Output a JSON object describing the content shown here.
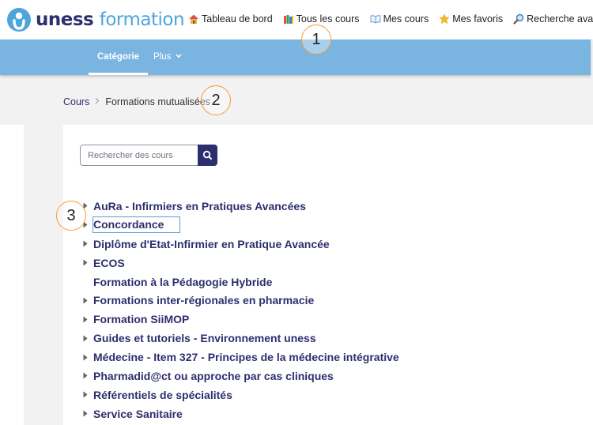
{
  "brand": {
    "name_part1": "uness",
    "name_part2": "formation"
  },
  "topnav": [
    {
      "label": "Tableau de bord",
      "icon": "house-icon"
    },
    {
      "label": "Tous les cours",
      "icon": "books-icon"
    },
    {
      "label": "Mes cours",
      "icon": "open-book-icon"
    },
    {
      "label": "Mes favoris",
      "icon": "star-icon"
    },
    {
      "label": "Recherche avancée",
      "icon": "magnifier-icon"
    }
  ],
  "subnav": {
    "active_tab": "Catégorie",
    "more_tab": "Plus"
  },
  "breadcrumb": {
    "root": "Cours",
    "current": "Formations mutualisées"
  },
  "search": {
    "placeholder": "Rechercher des cours",
    "value": ""
  },
  "categories": [
    {
      "label": "AuRa - Infirmiers en Pratiques Avancées",
      "expandable": true
    },
    {
      "label": "Concordance",
      "expandable": true
    },
    {
      "label": "Diplôme d'Etat-Infirmier en Pratique Avancée",
      "expandable": true
    },
    {
      "label": "ECOS",
      "expandable": true
    },
    {
      "label": "Formation à la Pédagogie Hybride",
      "expandable": false
    },
    {
      "label": "Formations inter-régionales en pharmacie",
      "expandable": true
    },
    {
      "label": "Formation SiiMOP",
      "expandable": true
    },
    {
      "label": "Guides et tutoriels - Environnement uness",
      "expandable": true
    },
    {
      "label": "Médecine - Item 327 - Principes de la médecine intégrative",
      "expandable": true
    },
    {
      "label": "Pharmadid@ct ou approche par cas cliniques",
      "expandable": true
    },
    {
      "label": "Référentiels de spécialités",
      "expandable": true
    },
    {
      "label": "Service Sanitaire",
      "expandable": true
    }
  ],
  "annotations": [
    "1",
    "2",
    "3"
  ],
  "colors": {
    "brand_dark": "#2d2e6e",
    "brand_light": "#4ea5dc",
    "subbar": "#7ab5e2",
    "callout": "#f0a030"
  }
}
